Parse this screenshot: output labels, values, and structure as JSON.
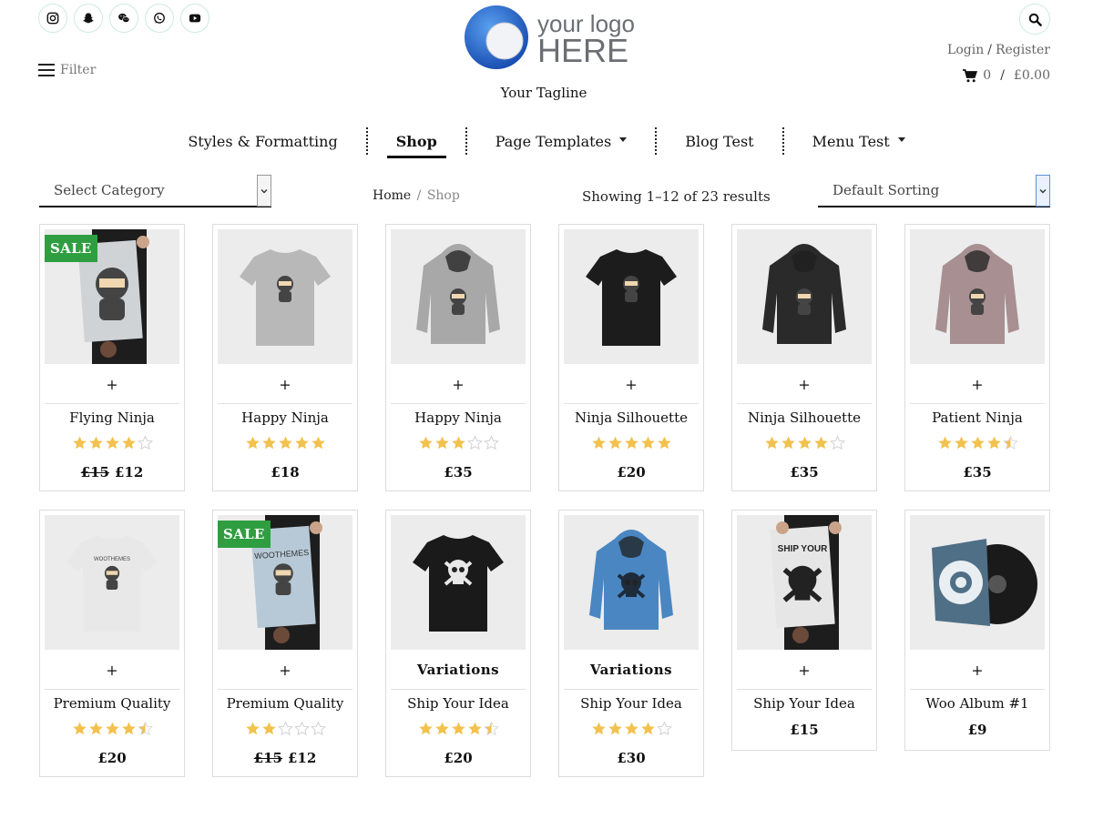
{
  "header": {
    "social": [
      {
        "icon": "instagram-icon"
      },
      {
        "icon": "snapchat-icon"
      },
      {
        "icon": "wechat-icon"
      },
      {
        "icon": "whatsapp-icon"
      },
      {
        "icon": "youtube-icon"
      }
    ],
    "logo_line1": "your logo",
    "logo_line2": "HERE",
    "tagline": "Your Tagline",
    "filter_label": "Filter",
    "login": "Login",
    "register": "Register",
    "cart_count": "0",
    "cart_total": "£0.00",
    "brand_blue": "#2f6fd6"
  },
  "nav": {
    "items": [
      {
        "label": "Styles & Formatting",
        "dropdown": false,
        "active": false
      },
      {
        "label": "Shop",
        "dropdown": false,
        "active": true
      },
      {
        "label": "Page Templates",
        "dropdown": true,
        "active": false
      },
      {
        "label": "Blog Test",
        "dropdown": false,
        "active": false
      },
      {
        "label": "Menu Test",
        "dropdown": true,
        "active": false
      }
    ]
  },
  "toolbar": {
    "category_select": "Select Category",
    "breadcrumb_home": "Home",
    "breadcrumb_current": "Shop",
    "results": "Showing 1–12 of 23 results",
    "sort_select": "Default Sorting"
  },
  "products": [
    {
      "title": "Flying Ninja",
      "action": "+",
      "rating": 4,
      "old_price": "£15",
      "price": "£12",
      "sale": true,
      "sale_label": "SALE",
      "image": "poster-ninja"
    },
    {
      "title": "Happy Ninja",
      "action": "+",
      "rating": 5,
      "old_price": "",
      "price": "£18",
      "sale": false,
      "image": "tshirt-grey"
    },
    {
      "title": "Happy Ninja",
      "action": "+",
      "rating": 3,
      "old_price": "",
      "price": "£35",
      "sale": false,
      "image": "hoodie-grey"
    },
    {
      "title": "Ninja Silhouette",
      "action": "+",
      "rating": 5,
      "old_price": "",
      "price": "£20",
      "sale": false,
      "image": "tshirt-black"
    },
    {
      "title": "Ninja Silhouette",
      "action": "+",
      "rating": 4,
      "old_price": "",
      "price": "£35",
      "sale": false,
      "image": "hoodie-black"
    },
    {
      "title": "Patient Ninja",
      "action": "+",
      "rating": 4.5,
      "old_price": "",
      "price": "£35",
      "sale": false,
      "image": "hoodie-mauve"
    },
    {
      "title": "Premium Quality",
      "action": "+",
      "rating": 4.5,
      "old_price": "",
      "price": "£20",
      "sale": false,
      "image": "tshirt-white"
    },
    {
      "title": "Premium Quality",
      "action": "+",
      "rating": 2,
      "old_price": "£15",
      "price": "£12",
      "sale": true,
      "sale_label": "SALE",
      "image": "poster-woo"
    },
    {
      "title": "Ship Your Idea",
      "action": "Variations",
      "rating": 4.5,
      "old_price": "",
      "price": "£20",
      "sale": false,
      "image": "tshirt-black-skull"
    },
    {
      "title": "Ship Your Idea",
      "action": "Variations",
      "rating": 4,
      "old_price": "",
      "price": "£30",
      "sale": false,
      "image": "hoodie-blue"
    },
    {
      "title": "Ship Your Idea",
      "action": "+",
      "rating": null,
      "old_price": "",
      "price": "£15",
      "sale": false,
      "image": "poster-skull"
    },
    {
      "title": "Woo Album #1",
      "action": "+",
      "rating": null,
      "old_price": "",
      "price": "£9",
      "sale": false,
      "image": "album"
    }
  ],
  "colors": {
    "sale_green": "#2f9e41",
    "star_gold": "#f2c14e",
    "star_empty": "#cfcfcf"
  }
}
